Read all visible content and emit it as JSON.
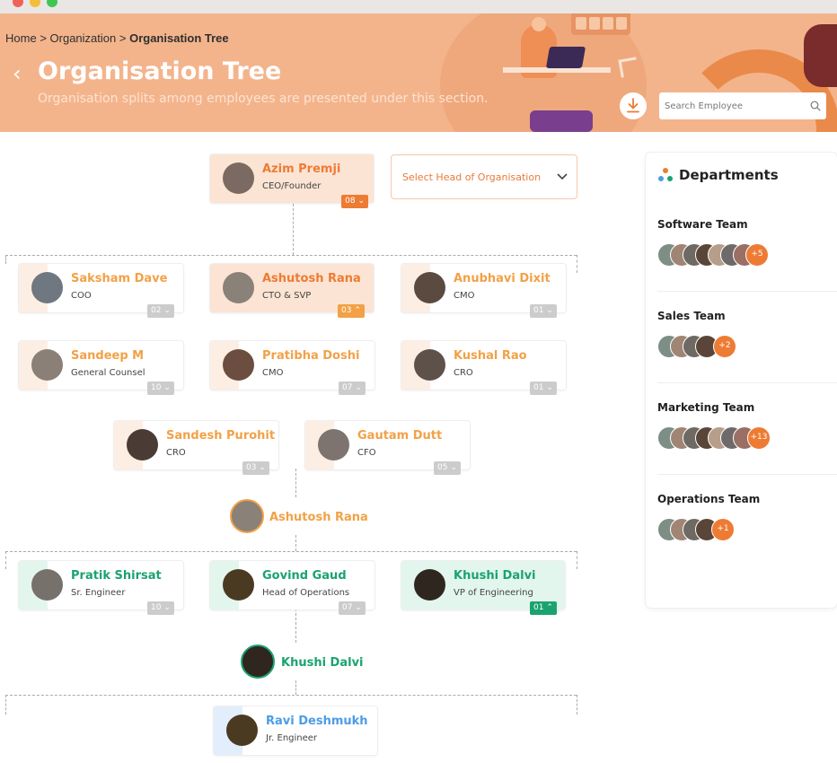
{
  "breadcrumb": {
    "home": "Home",
    "sep1": ">",
    "org": "Organization",
    "sep2": ">",
    "current": "Organisation Tree"
  },
  "header": {
    "title": "Organisation Tree",
    "subtitle": "Organisation splits among employees are presented under this section.",
    "search_placeholder": "Search Employee"
  },
  "select_head": {
    "label": "Select Head of Organisation"
  },
  "colors": {
    "orange": "#ee7b34",
    "green": "#1aa36f",
    "blue": "#4c9ce6",
    "muted": "#cccccc"
  },
  "root": {
    "name": "Azim Premji",
    "role": "CEO/Founder",
    "count": "08"
  },
  "level1": [
    {
      "name": "Saksham Dave",
      "role": "COO",
      "count": "02"
    },
    {
      "name": "Ashutosh Rana",
      "role": "CTO & SVP",
      "count": "03"
    },
    {
      "name": "Anubhavi Dixit",
      "role": "CMO",
      "count": "01"
    },
    {
      "name": "Sandeep M",
      "role": "General Counsel",
      "count": "10"
    },
    {
      "name": "Pratibha Doshi",
      "role": "CMO",
      "count": "07"
    },
    {
      "name": "Kushal Rao",
      "role": "CRO",
      "count": "01"
    },
    {
      "name": "Sandesh Purohit",
      "role": "CRO",
      "count": "03"
    },
    {
      "name": "Gautam Dutt",
      "role": "CFO",
      "count": "05"
    }
  ],
  "node1": {
    "name": "Ashutosh Rana"
  },
  "level2": [
    {
      "name": "Pratik Shirsat",
      "role": "Sr. Engineer",
      "count": "10"
    },
    {
      "name": "Govind Gaud",
      "role": "Head of Operations",
      "count": "07"
    },
    {
      "name": "Khushi Dalvi",
      "role": "VP of Engineering",
      "count": "01"
    }
  ],
  "node2": {
    "name": "Khushi Dalvi"
  },
  "level3": [
    {
      "name": "Ravi Deshmukh",
      "role": "Jr. Engineer"
    }
  ],
  "departments": {
    "title": "Departments",
    "items": [
      {
        "name": "Software Team",
        "more": "+5",
        "avatars": 7
      },
      {
        "name": "Sales Team",
        "more": "+2",
        "avatars": 3
      },
      {
        "name": "Marketing Team",
        "more": "+13",
        "avatars": 6
      },
      {
        "name": "Operations Team",
        "more": "+1",
        "avatars": 3
      }
    ]
  }
}
